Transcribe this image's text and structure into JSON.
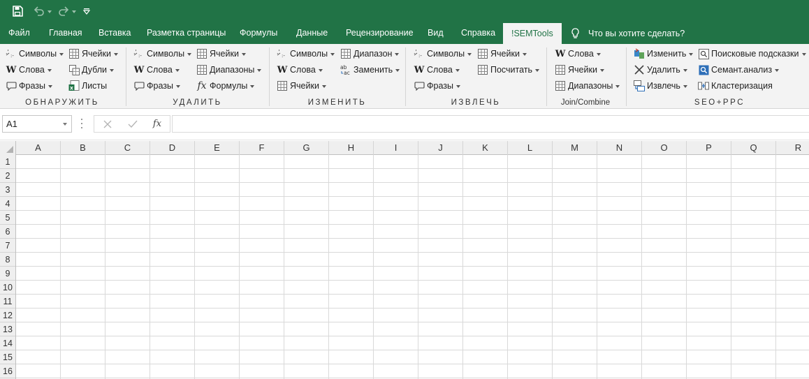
{
  "quick_access": {
    "save_icon": "save-icon",
    "undo_icon": "undo-icon",
    "redo_icon": "redo-icon",
    "customize_icon": "customize-qat-icon"
  },
  "tabs": [
    {
      "label": "Файл"
    },
    {
      "label": "Главная"
    },
    {
      "label": "Вставка"
    },
    {
      "label": "Разметка страницы"
    },
    {
      "label": "Формулы"
    },
    {
      "label": "Данные"
    },
    {
      "label": "Рецензирование"
    },
    {
      "label": "Вид"
    },
    {
      "label": "Справка"
    },
    {
      "label": "!SEMTools",
      "active": true
    }
  ],
  "tell_me": "Что вы хотите сделать?",
  "ribbon": {
    "groups": [
      {
        "label": "ОБНАРУЖИТЬ",
        "buttons": [
          "Символы",
          "Слова",
          "Фразы",
          "Ячейки",
          "Дубли",
          "Листы"
        ]
      },
      {
        "label": "УДАЛИТЬ",
        "buttons": [
          "Символы",
          "Слова",
          "Фразы",
          "Ячейки",
          "Диапазоны",
          "Формулы"
        ]
      },
      {
        "label": "ИЗМЕНИТЬ",
        "buttons": [
          "Символы",
          "Слова",
          "Ячейки",
          "Диапазон",
          "Заменить"
        ]
      },
      {
        "label": "ИЗВЛЕЧЬ",
        "buttons": [
          "Символы",
          "Слова",
          "Фразы",
          "Ячейки",
          "Посчитать"
        ]
      },
      {
        "label": "Join/Combine",
        "buttons": [
          "Слова",
          "Ячейки",
          "Диапазоны"
        ]
      },
      {
        "label": "SEO+PPC",
        "buttons": [
          "Изменить",
          "Удалить",
          "Извлечь",
          "Поисковые подсказки",
          "Семант.анализ",
          "Кластеризация"
        ]
      }
    ]
  },
  "formula_bar": {
    "name_box": "A1",
    "formula": "",
    "cancel_icon": "cancel-icon",
    "enter_icon": "enter-icon",
    "fx_label": "fx"
  },
  "sheet": {
    "columns": [
      "A",
      "B",
      "C",
      "D",
      "E",
      "F",
      "G",
      "H",
      "I",
      "J",
      "K",
      "L",
      "M",
      "N",
      "O",
      "P",
      "Q",
      "R"
    ],
    "rows": [
      "1",
      "2",
      "3",
      "4",
      "5",
      "6",
      "7",
      "8",
      "9",
      "10",
      "11",
      "12",
      "13",
      "14",
      "15",
      "16"
    ]
  },
  "colors": {
    "accent": "#217346",
    "ribbon_bg": "#f3f3f3",
    "header_bg": "#efefef"
  }
}
